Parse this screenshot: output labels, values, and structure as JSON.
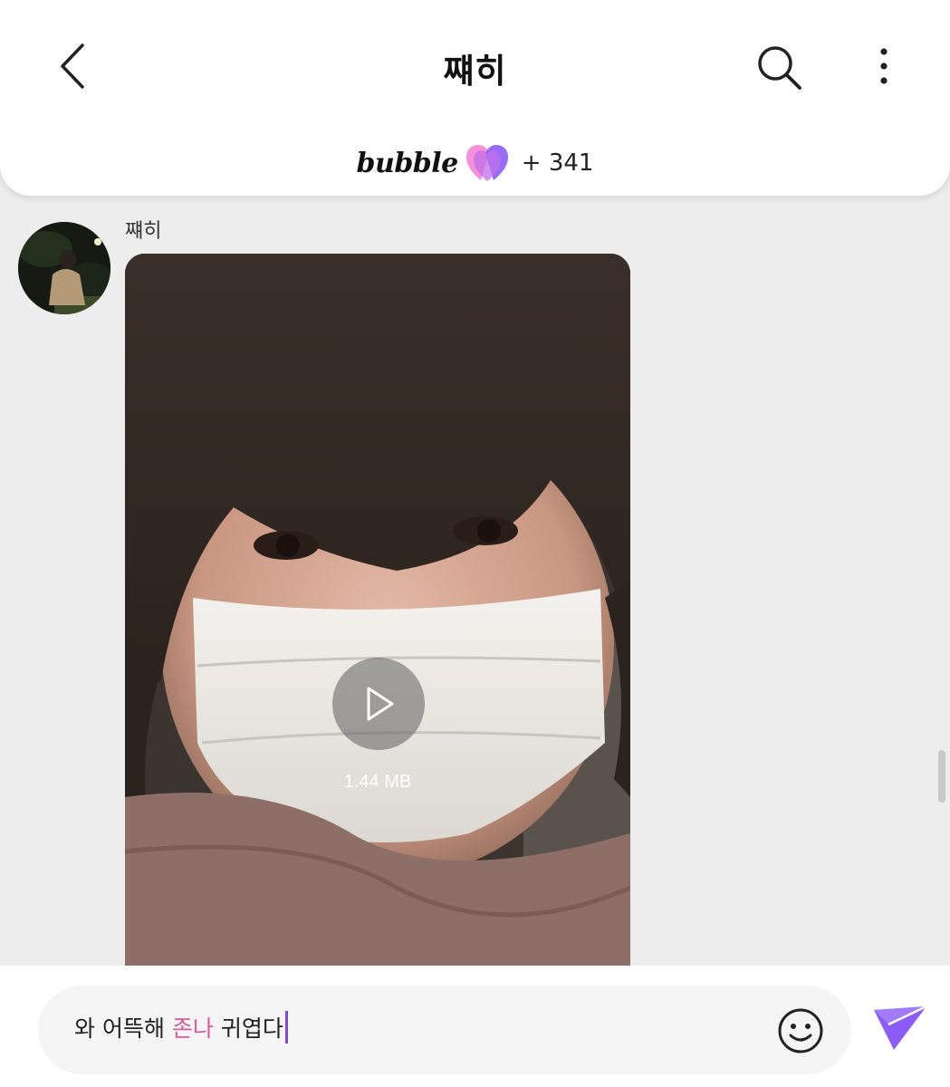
{
  "header": {
    "title": "쨰히",
    "brand": "bubble",
    "reaction_count": "+ 341"
  },
  "icons": {
    "back": "chevron-left-icon",
    "search": "search-icon",
    "more": "more-vertical-icon",
    "heart": "heart-icon",
    "play": "play-icon",
    "emoji": "smiley-icon",
    "send": "send-icon"
  },
  "message": {
    "sender": "쨰히",
    "video_size": "1.44 MB"
  },
  "composer": {
    "text_before": "와 어뜩해 ",
    "text_highlight": "존나",
    "text_after": " 귀엽다"
  },
  "colors": {
    "accent": "#8b5cf6",
    "highlight": "#d65c9e",
    "heart_pink": "#f07ad0",
    "heart_purple": "#8c5cf5"
  }
}
